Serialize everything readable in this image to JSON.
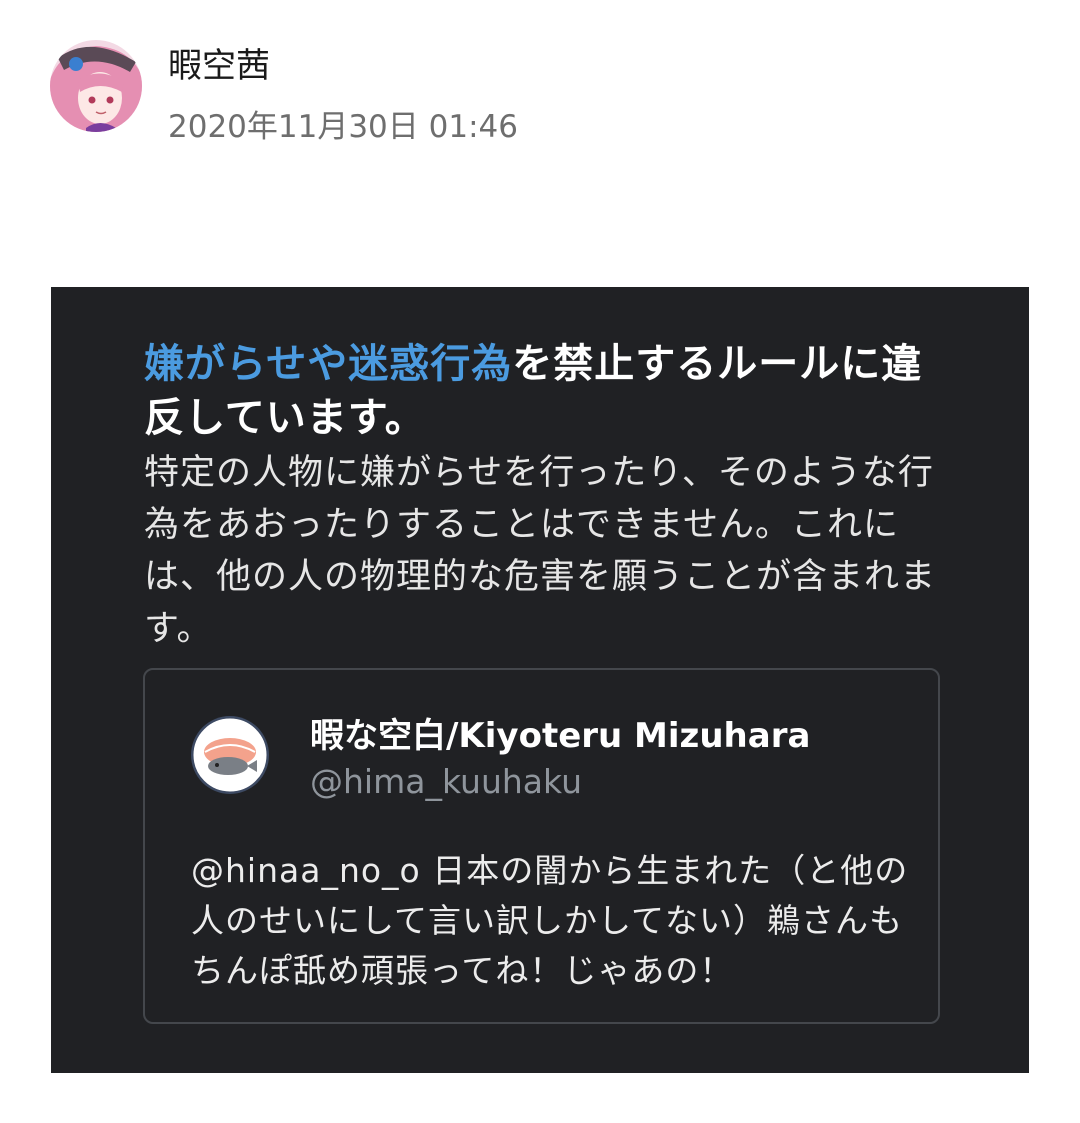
{
  "post": {
    "author_name": "暇空茜",
    "timestamp": "2020年11月30日 01:46"
  },
  "notice": {
    "title_highlight": "嫌がらせや迷惑行為",
    "title_rest": "を禁止するルールに違反しています。",
    "description": "特定の人物に嫌がらせを行ったり、そのような行為をあおったりすることはできません。これには、他の人の物理的な危害を願うことが含まれます。",
    "highlight_color": "#4b9be0"
  },
  "tweet": {
    "display_name": "暇な空白/Kiyoteru Mizuhara",
    "handle": "@hima_kuuhaku",
    "text": "@hinaa_no_o 日本の闇から生まれた（と他の人のせいにして言い訳しかしてない）鵜さんもちんぽ舐め頑張ってね！じゃあの！"
  }
}
